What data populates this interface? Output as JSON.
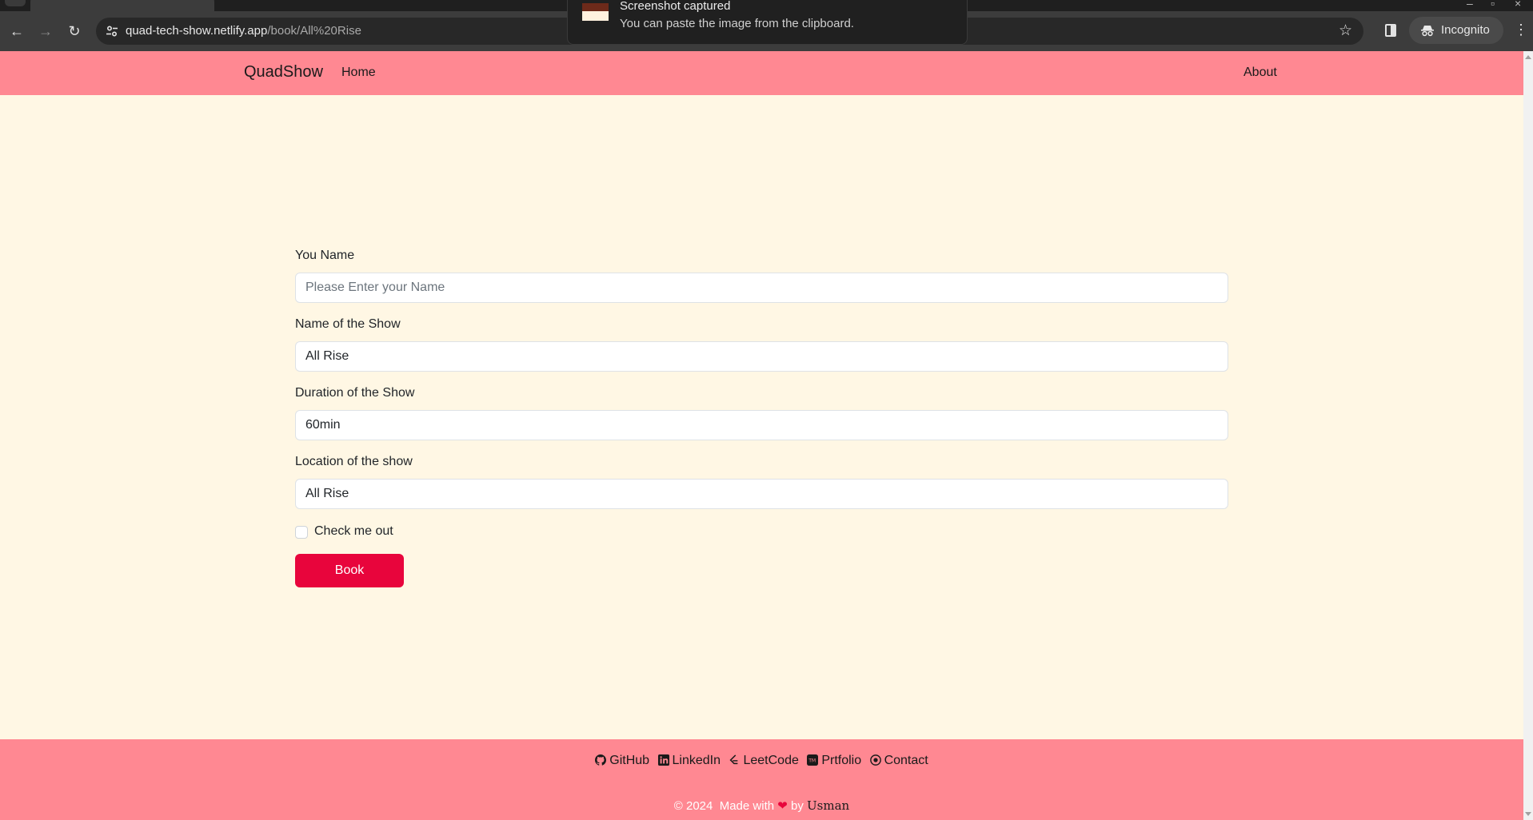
{
  "browser": {
    "url_host": "quad-tech-show.netlify.app",
    "url_path": "/book/All%20Rise",
    "incognito_label": "Incognito"
  },
  "notification": {
    "title": "Screenshot captured",
    "message": "You can paste the image from the clipboard."
  },
  "navbar": {
    "brand": "QuadShow",
    "home": "Home",
    "about": "About",
    "color": "#ff8892"
  },
  "form": {
    "name_label": "You Name",
    "name_placeholder": "Please Enter your Name",
    "show_label": "Name of the Show",
    "show_value": "All Rise",
    "duration_label": "Duration of the Show",
    "duration_value": "60min",
    "location_label": "Location of the show",
    "location_value": "All Rise",
    "check_label": "Check me out",
    "check_checked": false,
    "submit_label": "Book",
    "submit_color": "#e8053c"
  },
  "footer": {
    "links": {
      "github": "GitHub",
      "linkedin": "LinkedIn",
      "leetcode": "LeetCode",
      "portfolio": "Prtfolio",
      "contact": "Contact"
    },
    "copyright": "© 2024",
    "made_with": "Made with",
    "by": "by",
    "author": "Usman"
  }
}
